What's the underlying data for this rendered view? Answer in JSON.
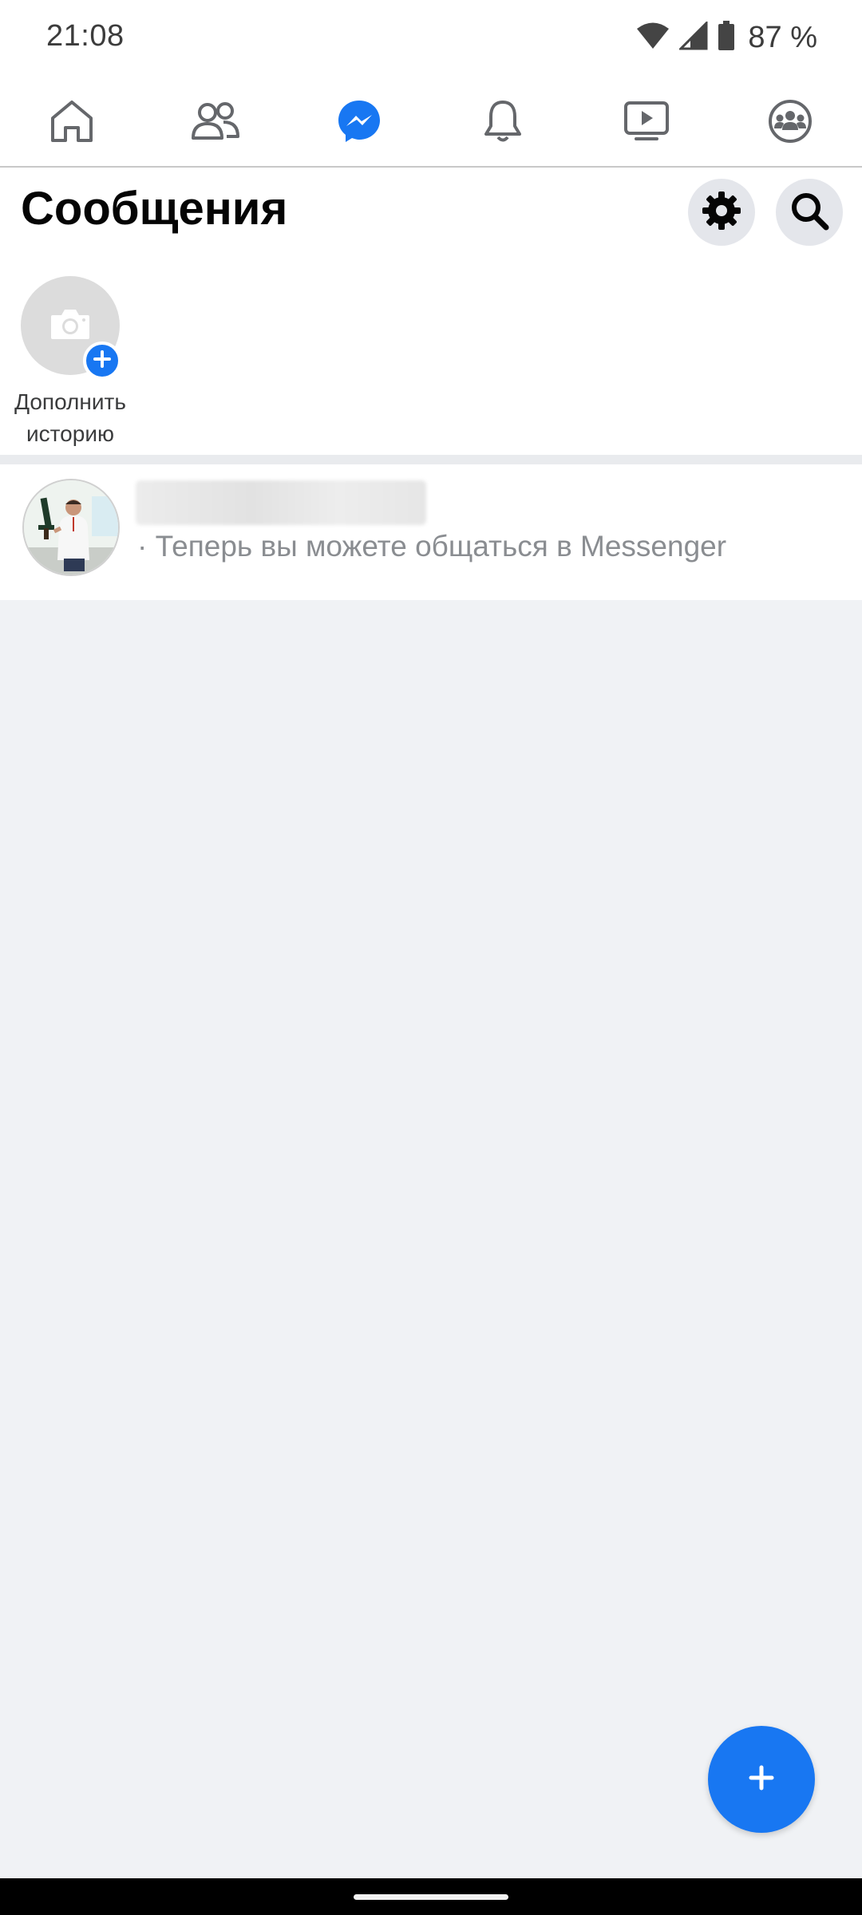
{
  "status_bar": {
    "time": "21:08",
    "battery": "87 %",
    "icons": [
      "wifi-icon",
      "cell-signal-icon",
      "battery-icon"
    ]
  },
  "nav": {
    "tabs": [
      {
        "name": "home",
        "icon": "home-icon",
        "active": false
      },
      {
        "name": "friends",
        "icon": "friends-icon",
        "active": false
      },
      {
        "name": "messenger",
        "icon": "messenger-icon",
        "active": true
      },
      {
        "name": "notifications",
        "icon": "bell-icon",
        "active": false
      },
      {
        "name": "watch",
        "icon": "video-play-icon",
        "active": false
      },
      {
        "name": "groups",
        "icon": "groups-icon",
        "active": false
      }
    ]
  },
  "header": {
    "title": "Сообщения",
    "actions": [
      "gear-icon",
      "search-icon"
    ]
  },
  "stories": {
    "add_label_line1": "Дополнить",
    "add_label_line2": "историю"
  },
  "conversations": [
    {
      "name": "",
      "name_obscured": true,
      "preview": "· Теперь вы можете общаться в Messenger"
    }
  ],
  "fab": {
    "icon": "plus-icon"
  },
  "colors": {
    "accent": "#1877f2",
    "background": "#f0f2f5",
    "text_primary": "#050505",
    "text_secondary": "#8a8d91",
    "icon_gray": "#65676b"
  }
}
